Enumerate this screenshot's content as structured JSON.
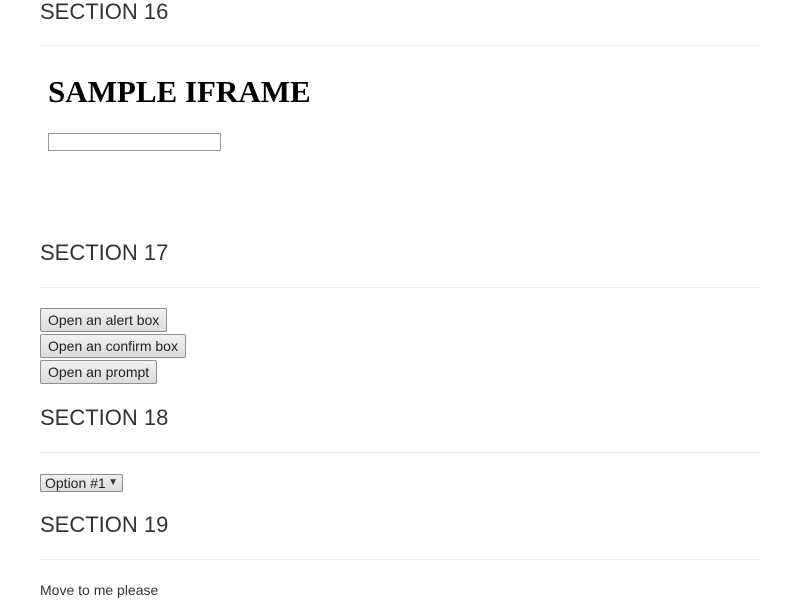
{
  "sections": {
    "s16": {
      "title": "SECTION 16"
    },
    "s17": {
      "title": "SECTION 17"
    },
    "s18": {
      "title": "SECTION 18"
    },
    "s19": {
      "title": "SECTION 19"
    }
  },
  "iframe": {
    "heading": "SAMPLE IFRAME",
    "input_value": ""
  },
  "dialogs": {
    "alert_label": "Open an alert box",
    "confirm_label": "Open an confirm box",
    "prompt_label": "Open an prompt"
  },
  "dropdown": {
    "selected": "Option #1"
  },
  "hover": {
    "text": "Move to me please"
  }
}
